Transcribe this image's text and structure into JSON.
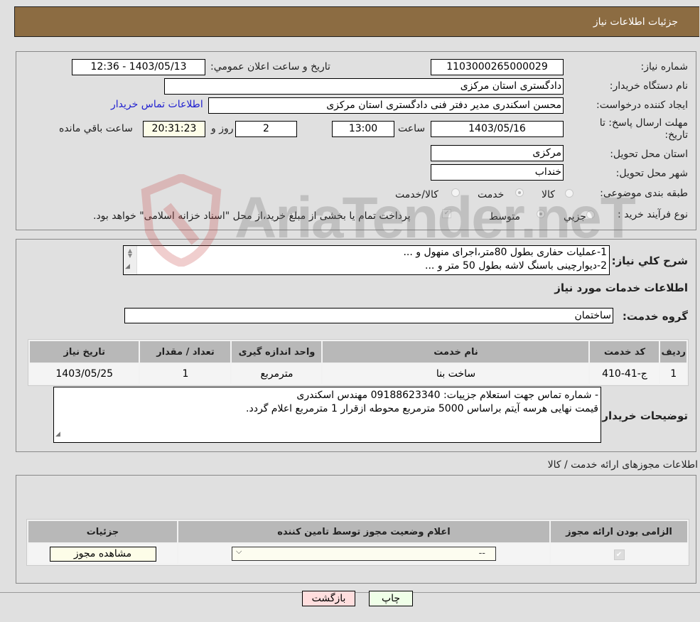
{
  "header": {
    "title": "جزئیات اطلاعات نیاز"
  },
  "details": {
    "need_number_label": "شماره نیاز:",
    "need_number": "1103000265000029",
    "announce_label": "تاریخ و ساعت اعلان عمومي:",
    "announce_value": "1403/05/13 - 12:36",
    "buyer_org_label": "نام دستگاه خریدار:",
    "buyer_org": "دادگستری استان مرکزی",
    "creator_label": "ایجاد کننده درخواست:",
    "creator": "محسن اسکندری مدیر دفتر فنی دادگستری استان مرکزی",
    "buyer_contact_link": "اطلاعات تماس خریدار",
    "deadline_label_line1": "مهلت ارسال پاسخ: تا",
    "deadline_label_line2": "تاریخ:",
    "deadline_date": "1403/05/16",
    "time_label": "ساعت",
    "deadline_time": "13:00",
    "days_value": "2",
    "days_label": "روز و",
    "remaining_time": "20:31:23",
    "remaining_label": "ساعت باقي مانده",
    "province_label": "استان محل تحویل:",
    "province": "مرکزی",
    "city_label": "شهر محل تحویل:",
    "city": "خنداب",
    "category_label": "طبقه بندی موضوعی:",
    "category_options": [
      {
        "label": "کالا",
        "checked": false
      },
      {
        "label": "خدمت",
        "checked": true
      },
      {
        "label": "کالا/خدمت",
        "checked": false
      }
    ],
    "process_label": "نوع فرآیند خرید :",
    "process_options": [
      {
        "label": "جزيي",
        "checked": false
      },
      {
        "label": "متوسط",
        "checked": true
      }
    ],
    "treasury_checkbox_label": "پرداخت تمام یا بخشی از مبلغ خرید،از محل \"اسناد خزانه اسلامی\" خواهد بود.",
    "treasury_checked": true
  },
  "summary": {
    "label": "شرح کلي نیاز:",
    "lines": [
      "1-عملیات حفاری بطول 80متر،اجرای منهول و ...",
      "2-دیوارچینی باسنگ لاشه بطول 50 متر و ..."
    ],
    "services_heading": "اطلاعات خدمات مورد نیاز",
    "service_group_label": "گروه خدمت:",
    "service_group": "ساختمان"
  },
  "services_table": {
    "headers": [
      "ردیف",
      "کد خدمت",
      "نام خدمت",
      "واحد اندازه گیری",
      "تعداد / مقدار",
      "تاریخ نیاز"
    ],
    "rows": [
      [
        "1",
        "ج-41-410",
        "ساخت بنا",
        "مترمربع",
        "1",
        "1403/05/25"
      ]
    ]
  },
  "buyer_notes": {
    "label": "توضیحات خریدار:",
    "lines": [
      "- شماره تماس جهت استعلام جزییات: 09188623340 مهندس اسکندری",
      "قیمت نهایی هرسه آیتم براساس 5000 مترمربع محوطه ازقرار 1 مترمربع اعلام گردد."
    ]
  },
  "permits": {
    "heading": "اطلاعات مجوزهای ارائه خدمت / کالا",
    "headers": [
      "الزامی بودن ارائه مجوز",
      "اعلام وضعیت مجوز توسط تامین کننده",
      "جزئیات"
    ],
    "required_checked": true,
    "status_selected": "--",
    "view_button": "مشاهده مجوز"
  },
  "footer": {
    "print_button": "چاپ",
    "back_button": "بازگشت"
  },
  "watermark": {
    "text": "AriaTender.neT"
  }
}
